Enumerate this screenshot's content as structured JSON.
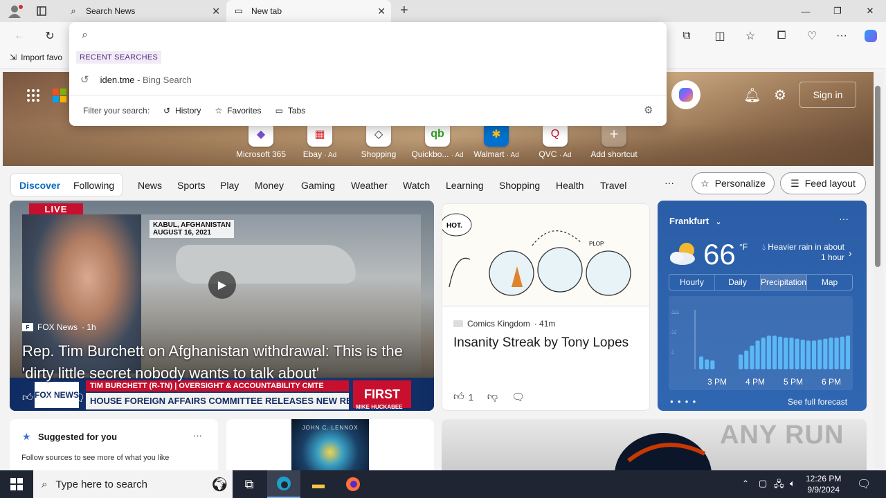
{
  "browser": {
    "tabs": [
      {
        "title": "Search News",
        "icon": "search-icon"
      },
      {
        "title": "New tab",
        "icon": "newtab-icon"
      }
    ],
    "new_tab_symbol": "+",
    "window": {
      "minimize": "—",
      "maximize": "❐",
      "close": "✕"
    },
    "favorites_bar": {
      "import": "Import favo"
    }
  },
  "omnibox": {
    "value": "",
    "recent_label": "RECENT SEARCHES",
    "recent": [
      {
        "query": "iden.tme",
        "suffix": "- Bing Search"
      }
    ],
    "filter_label": "Filter your search:",
    "filters": [
      "History",
      "Favorites",
      "Tabs"
    ]
  },
  "shortcuts": [
    {
      "label": "Microsoft 365",
      "ad": ""
    },
    {
      "label": "Ebay",
      "ad": "· Ad"
    },
    {
      "label": "Shopping",
      "ad": ""
    },
    {
      "label": "Quickbo...",
      "ad": "· Ad"
    },
    {
      "label": "Walmart",
      "ad": "· Ad"
    },
    {
      "label": "QVC",
      "ad": "· Ad"
    },
    {
      "label": "Add shortcut",
      "ad": ""
    }
  ],
  "header": {
    "signin": "Sign in"
  },
  "nav": {
    "items": [
      "Discover",
      "Following",
      "News",
      "Sports",
      "Play",
      "Money",
      "Gaming",
      "Weather",
      "Watch",
      "Learning",
      "Shopping",
      "Health",
      "Travel"
    ],
    "more": "···",
    "personalize": "Personalize",
    "feed_layout": "Feed layout"
  },
  "main_story": {
    "live": "LIVE",
    "dateline": [
      "KABUL, AFGHANISTAN",
      "AUGUST 16, 2021"
    ],
    "source": "FOX News",
    "age": "· 1h",
    "title": "Rep. Tim Burchett on Afghanistan withdrawal: This is the 'dirty little secret nobody wants to talk about'",
    "lower_third": [
      "TIM BURCHETT (R-TN) | OVERSIGHT & ACCOUNTABILITY CMTE",
      "HOUSE FOREIGN AFFAIRS COMMITTEE RELEASES NEW REPORT ON AFGHANISTAN WITHDRAWAL"
    ],
    "show": "FIRST",
    "host": "MIKE HUCKABEE",
    "logo": "FOX NEWS"
  },
  "comic_story": {
    "source": "Comics Kingdom",
    "age": "· 41m",
    "title": "Insanity Streak by Tony Lopes",
    "likes": "1",
    "caption": [
      "HOT.",
      "PLOP"
    ]
  },
  "weather": {
    "city": "Frankfurt",
    "temp": "66",
    "unit": "°F",
    "condition": "Heavier rain in about 1 hour",
    "tabs": [
      "Hourly",
      "Daily",
      "Precipitation",
      "Map"
    ],
    "active_tab": "Precipitation",
    "times": [
      "3 PM",
      "4 PM",
      "5 PM",
      "6 PM"
    ],
    "forecast_link": "See full forecast",
    "more": "···"
  },
  "chart_data": {
    "type": "bar",
    "title": "",
    "xlabel": "",
    "ylabel": "",
    "x_ticks": [
      "3 PM",
      "4 PM",
      "5 PM",
      "6 PM"
    ],
    "ylim": [
      0,
      3
    ],
    "values": [
      0.65,
      0.5,
      0.45,
      0.0,
      0.0,
      0.0,
      0.0,
      0.75,
      0.95,
      1.2,
      1.45,
      1.6,
      1.7,
      1.7,
      1.65,
      1.6,
      1.6,
      1.55,
      1.5,
      1.45,
      1.45,
      1.5,
      1.55,
      1.6,
      1.6,
      1.65,
      1.7
    ]
  },
  "suggested": {
    "title": "Suggested for you",
    "body": "Follow sources to see more of what you like",
    "more": "···"
  },
  "book": {
    "author": "JOHN C. LENNOX"
  },
  "watermark": "ANY RUN",
  "taskbar": {
    "search_placeholder": "Type here to search",
    "time": "12:26 PM",
    "date": "9/9/2024"
  }
}
